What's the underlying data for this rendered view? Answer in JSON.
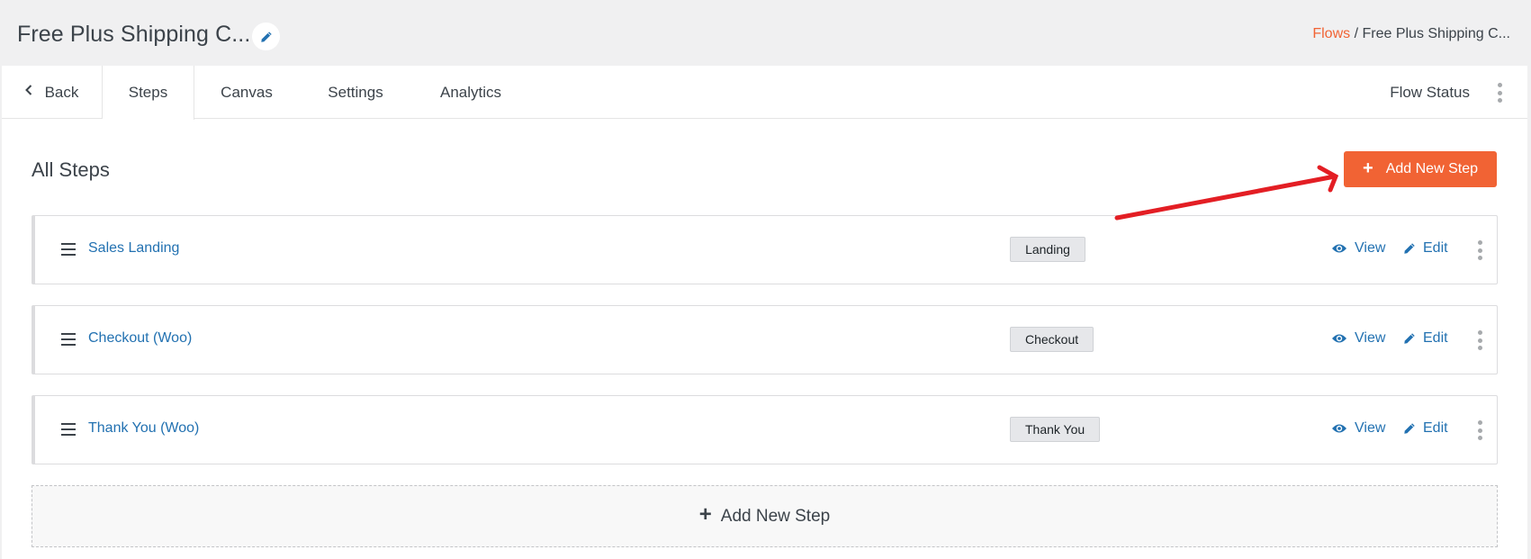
{
  "header": {
    "title": "Free Plus Shipping C...",
    "title_edit_icon": "pencil-icon",
    "breadcrumb": {
      "link": "Flows",
      "separator": " / ",
      "current": "Free Plus Shipping C..."
    }
  },
  "nav": {
    "back_label": "Back",
    "back_icon": "chevron-left-icon",
    "tabs": [
      {
        "label": "Steps",
        "active": true
      },
      {
        "label": "Canvas",
        "active": false
      },
      {
        "label": "Settings",
        "active": false
      },
      {
        "label": "Analytics",
        "active": false
      }
    ],
    "flow_status_label": "Flow Status",
    "more_icon": "kebab-menu-icon"
  },
  "main": {
    "section_title": "All Steps",
    "add_button": {
      "icon": "plus-icon",
      "label": "Add New Step"
    },
    "steps": [
      {
        "name": "Sales Landing",
        "type": "Landing",
        "view_label": "View",
        "edit_label": "Edit"
      },
      {
        "name": "Checkout (Woo)",
        "type": "Checkout",
        "view_label": "View",
        "edit_label": "Edit"
      },
      {
        "name": "Thank You (Woo)",
        "type": "Thank You",
        "view_label": "View",
        "edit_label": "Edit"
      }
    ],
    "add_step_footer": {
      "icon": "plus-icon",
      "label": "Add New Step"
    }
  },
  "annotation": {
    "type": "red-arrow",
    "points_to": "add-new-step-button",
    "color": "#e31e24"
  },
  "colors": {
    "accent": "#f16334",
    "link": "#2271b1",
    "badge_bg": "#e6e7ea",
    "page_bg": "#f0f0f1"
  }
}
